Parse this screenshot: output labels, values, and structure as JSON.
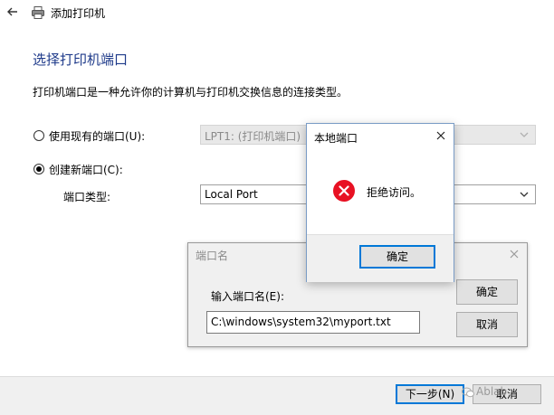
{
  "window": {
    "title": "添加打印机"
  },
  "main": {
    "heading": "选择打印机端口",
    "description": "打印机端口是一种允许你的计算机与打印机交换信息的连接类型。",
    "use_existing_label": "使用现有的端口(U):",
    "use_existing_value": "LPT1: (打印机端口)",
    "create_new_label": "创建新端口(C):",
    "port_type_label": "端口类型:",
    "port_type_value": "Local Port"
  },
  "footer": {
    "next_label": "下一步(N)",
    "cancel_label": "取消"
  },
  "port_name_dialog": {
    "title": "端口名",
    "prompt": "输入端口名(E):",
    "input_value": "C:\\windows\\system32\\myport.txt",
    "ok_label": "确定",
    "cancel_label": "取消"
  },
  "error_dialog": {
    "title": "本地端口",
    "message": "拒绝访问。",
    "ok_label": "确定"
  },
  "watermark": {
    "text": "Ablab"
  },
  "colors": {
    "heading": "#1e3a8a",
    "accent": "#0078d7",
    "error": "#e81123"
  },
  "icons": [
    "back-arrow-icon",
    "printer-icon",
    "chevron-down-icon",
    "close-icon",
    "error-icon",
    "wechat-icon"
  ]
}
